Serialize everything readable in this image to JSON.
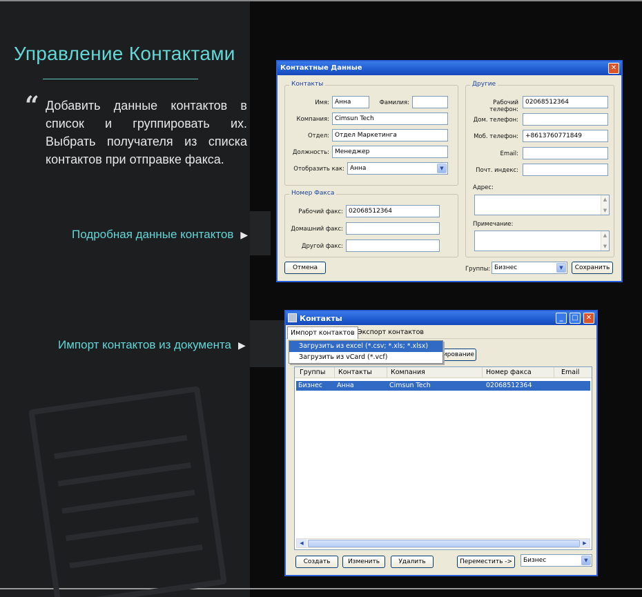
{
  "page": {
    "title": "Управление Контактами",
    "quote_symbol": "“",
    "description": "Добавить данные контактов в список и группировать их. Выбрать получателя из списка контактов при отправке факса.",
    "callouts": [
      {
        "label": "Подробная данные контактов",
        "arrow": "▶"
      },
      {
        "label": "Импорт контактов из документа",
        "arrow": "▶"
      }
    ],
    "colors": {
      "accent": "#63d6d6",
      "panel": "#1d1e20",
      "background": "#0b0b0b"
    }
  },
  "contact_dialog": {
    "title": "Контактные Данные",
    "close_icon": "close-icon",
    "contacts_group": {
      "legend": "Контакты",
      "first_name_label": "Имя:",
      "first_name_value": "Анна",
      "last_name_label": "Фамилия:",
      "last_name_value": "",
      "company_label": "Компания:",
      "company_value": "Cimsun Tech",
      "department_label": "Отдел:",
      "department_value": "Отдел Маркетинга",
      "position_label": "Должность:",
      "position_value": "Менеджер",
      "display_as_label": "Отобразить как:",
      "display_as_value": "Анна"
    },
    "fax_group": {
      "legend": "Номер Факса",
      "work_fax_label": "Рабочий факс:",
      "work_fax_value": "02068512364",
      "home_fax_label": "Домашний факс:",
      "home_fax_value": "",
      "other_fax_label": "Другой факс:",
      "other_fax_value": ""
    },
    "other_group": {
      "legend": "Другие",
      "work_phone_label": "Рабочий телефон:",
      "work_phone_value": "02068512364",
      "home_phone_label": "Дом. телефон:",
      "home_phone_value": "",
      "mobile_label": "Моб. телефон:",
      "mobile_value": "+8613760771849",
      "email_label": "Email:",
      "email_value": "",
      "postal_label": "Почт. индекс:",
      "postal_value": "",
      "address_label": "Адрес:",
      "note_label": "Примечание:"
    },
    "cancel_button": "Отмена",
    "groups_label": "Группы:",
    "groups_value": "Бизнес",
    "save_button": "Сохранить"
  },
  "contacts_window": {
    "title": "Контакты",
    "menu": [
      {
        "label": "Импорт контактов"
      },
      {
        "label": "Экспорт контактов"
      }
    ],
    "dropdown": [
      {
        "label": "Загрузить из excel (*.csv; *.xls; *.xlsx)"
      },
      {
        "label": "Загрузить из vCard (*.vcf)"
      }
    ],
    "hidden_button_fragment": "ирование",
    "columns": [
      "Группы",
      "Контакты",
      "Компания",
      "Номер факса",
      "Email"
    ],
    "rows": [
      {
        "group": "Бизнес",
        "contact": "Анна",
        "company": "Cimsun Tech",
        "fax": "02068512364",
        "email": ""
      }
    ],
    "buttons": {
      "create": "Создать",
      "edit": "Изменить",
      "delete": "Удалить",
      "move": "Переместить ->"
    },
    "group_select_value": "Бизнес"
  }
}
